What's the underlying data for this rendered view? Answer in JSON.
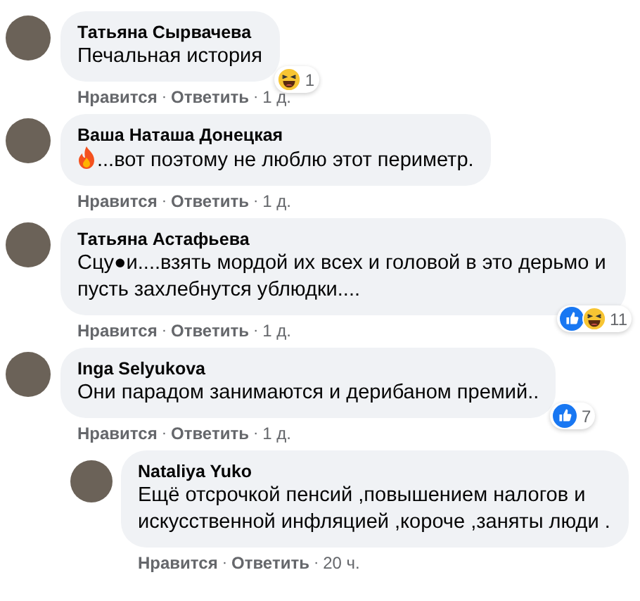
{
  "separator": "·",
  "comments": [
    {
      "author": "Татьяна Сырвачева",
      "text": "Печальная история",
      "reactions": [
        {
          "kind": "haha"
        }
      ],
      "reaction_count": "1",
      "actions": [
        "Нравится",
        "Ответить",
        "1 д."
      ],
      "is_reply": false
    },
    {
      "author": "Ваша Наташа Донецкая",
      "leading_emoji": {
        "kind": "fire"
      },
      "text": "...вот поэтому не люблю этот периметр.",
      "actions": [
        "Нравится",
        "Ответить",
        "1 д."
      ],
      "is_reply": false
    },
    {
      "author": "Татьяна Астафьева",
      "text": "Сцу●и....взять мордой их всех и головой в это дерьмо и пусть захлебнутся ублюдки....",
      "reactions": [
        {
          "kind": "like"
        },
        {
          "kind": "haha"
        }
      ],
      "reaction_count": "11",
      "actions": [
        "Нравится",
        "Ответить",
        "1 д."
      ],
      "is_reply": false
    },
    {
      "author": "Inga Selyukova",
      "text": "Они парадом занимаются и дерибаном премий..",
      "reactions": [
        {
          "kind": "like"
        }
      ],
      "reaction_count": "7",
      "actions": [
        "Нравится",
        "Ответить",
        "1 д."
      ],
      "is_reply": false
    },
    {
      "author": "Nataliya Yuko",
      "text": "Ещё отсрочкой пенсий ,повышением налогов и искусственной инфляцией ,короче ,заняты люди .",
      "actions": [
        "Нравится",
        "Ответить",
        "20 ч."
      ],
      "is_reply": true
    }
  ]
}
